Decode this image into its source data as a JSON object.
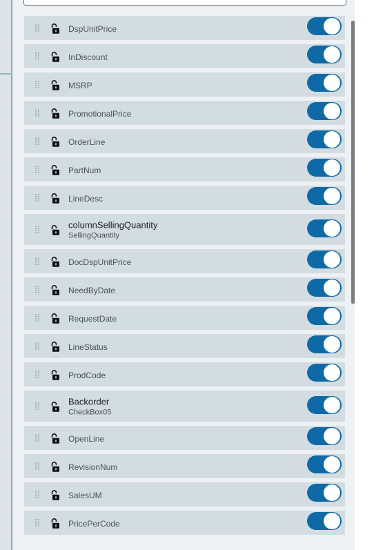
{
  "columns": [
    {
      "label": "DspUnitPrice",
      "sublabel": null,
      "enabled": true
    },
    {
      "label": "InDiscount",
      "sublabel": null,
      "enabled": true
    },
    {
      "label": "MSRP",
      "sublabel": null,
      "enabled": true
    },
    {
      "label": "PromotionalPrice",
      "sublabel": null,
      "enabled": true
    },
    {
      "label": "OrderLine",
      "sublabel": null,
      "enabled": true
    },
    {
      "label": "PartNum",
      "sublabel": null,
      "enabled": true
    },
    {
      "label": "LineDesc",
      "sublabel": null,
      "enabled": true
    },
    {
      "label": "columnSellingQuantity",
      "sublabel": "SellingQuantity",
      "enabled": true
    },
    {
      "label": "DocDspUnitPrice",
      "sublabel": null,
      "enabled": true
    },
    {
      "label": "NeedByDate",
      "sublabel": null,
      "enabled": true
    },
    {
      "label": "RequestDate",
      "sublabel": null,
      "enabled": true
    },
    {
      "label": "LineStatus",
      "sublabel": null,
      "enabled": true
    },
    {
      "label": "ProdCode",
      "sublabel": null,
      "enabled": true
    },
    {
      "label": "Backorder",
      "sublabel": "CheckBox05",
      "enabled": true
    },
    {
      "label": "OpenLine",
      "sublabel": null,
      "enabled": true
    },
    {
      "label": "RevisionNum",
      "sublabel": null,
      "enabled": true
    },
    {
      "label": "SalesUM",
      "sublabel": null,
      "enabled": true
    },
    {
      "label": "PricePerCode",
      "sublabel": null,
      "enabled": true
    }
  ],
  "icons": {
    "drag": "drag-handle-icon",
    "lock": "unlocked-padlock-icon"
  },
  "colors": {
    "toggle_on": "#0e6aa6",
    "row_bg": "#d3dde1",
    "panel_bg": "#eef1f3"
  }
}
